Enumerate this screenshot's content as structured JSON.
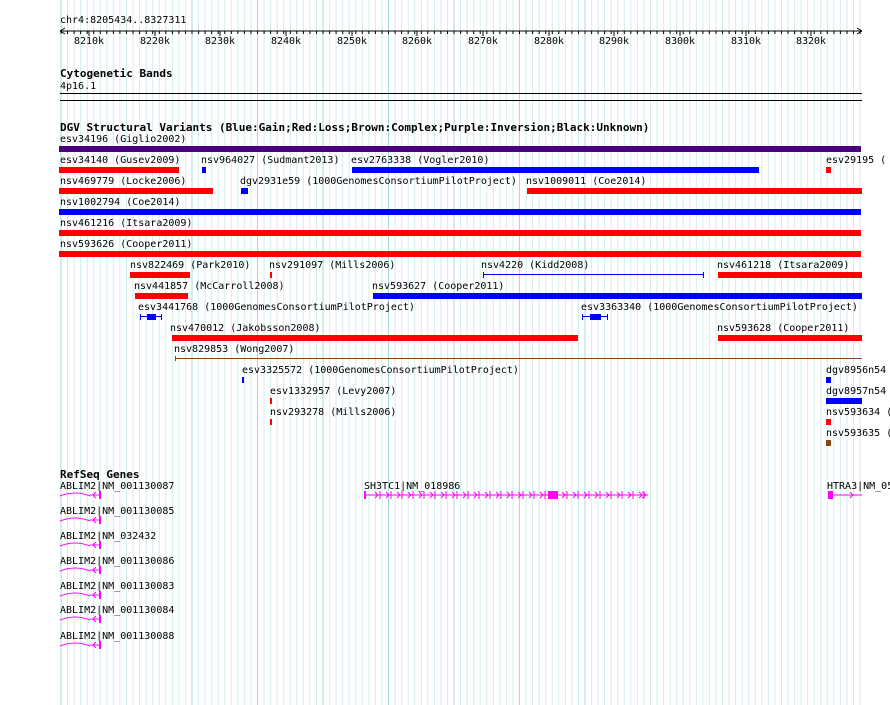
{
  "coordinate": "chr4:8205434..8327311",
  "axis_ticks": [
    "8210k",
    "8220k",
    "8230k",
    "8240k",
    "8250k",
    "8260k",
    "8270k",
    "8280k",
    "8290k",
    "8300k",
    "8310k",
    "8320k"
  ],
  "cytoband": {
    "title": "Cytogenetic Bands",
    "band": "4p16.1"
  },
  "dgv": {
    "title": "DGV Structural Variants (Blue:Gain;Red:Loss;Brown:Complex;Purple:Inversion;Black:Unknown)",
    "colors": {
      "gain": "#0000ff",
      "loss": "#ff0000",
      "complex": "#8b4513",
      "inversion": "#4b0082",
      "thin": "#b22222"
    },
    "features": [
      {
        "label": "esv34196 (Giglio2002)",
        "type": "inversion"
      },
      {
        "label": "esv34140 (Gusev2009)",
        "type": "loss"
      },
      {
        "label": "nsv964027 (Sudmant2013)",
        "type": "gain"
      },
      {
        "label": "esv2763338 (Vogler2010)",
        "type": "gain"
      },
      {
        "label": "esv29195 (",
        "type": "loss"
      },
      {
        "label": "nsv469779 (Locke2006)",
        "type": "loss"
      },
      {
        "label": "dgv2931e59 (1000GenomesConsortiumPilotProject)",
        "type": "gain"
      },
      {
        "label": "nsv1009011 (Coe2014)",
        "type": "loss"
      },
      {
        "label": "nsv1002794 (Coe2014)",
        "type": "gain"
      },
      {
        "label": "nsv461216 (Itsara2009)",
        "type": "loss"
      },
      {
        "label": "nsv593626 (Cooper2011)",
        "type": "loss"
      },
      {
        "label": "nsv822469 (Park2010)",
        "type": "loss"
      },
      {
        "label": "nsv291097 (Mills2006)",
        "type": "loss"
      },
      {
        "label": "nsv4220 (Kidd2008)",
        "type": "gain"
      },
      {
        "label": "nsv461218 (Itsara2009)",
        "type": "loss"
      },
      {
        "label": "nsv441857 (McCarroll2008)",
        "type": "loss"
      },
      {
        "label": "nsv593627 (Cooper2011)",
        "type": "gain"
      },
      {
        "label": "esv3441768 (1000GenomesConsortiumPilotProject)",
        "type": "gain"
      },
      {
        "label": "esv3363340 (1000GenomesConsortiumPilotProject)",
        "type": "gain"
      },
      {
        "label": "nsv470012 (Jakobsson2008)",
        "type": "loss"
      },
      {
        "label": "nsv593628 (Cooper2011)",
        "type": "loss"
      },
      {
        "label": "nsv829853 (Wong2007)",
        "type": "loss"
      },
      {
        "label": "esv3325572 (1000GenomesConsortiumPilotProject)",
        "type": "gain"
      },
      {
        "label": "dgv8956n54",
        "type": "gain"
      },
      {
        "label": "esv1332957 (Levy2007)",
        "type": "loss"
      },
      {
        "label": "dgv8957n54",
        "type": "gain"
      },
      {
        "label": "nsv293278 (Mills2006)",
        "type": "loss"
      },
      {
        "label": "nsv593634 (",
        "type": "loss"
      },
      {
        "label": "nsv593635 (",
        "type": "complex"
      }
    ]
  },
  "refseq": {
    "title": "RefSeq Genes",
    "color": "#ff00ff",
    "genes": [
      {
        "label": "ABLIM2|NM_001130087"
      },
      {
        "label": "ABLIM2|NM_001130085"
      },
      {
        "label": "ABLIM2|NM_032432"
      },
      {
        "label": "ABLIM2|NM_001130086"
      },
      {
        "label": "ABLIM2|NM_001130083"
      },
      {
        "label": "ABLIM2|NM_001130084"
      },
      {
        "label": "ABLIM2|NM_001130088"
      },
      {
        "label": "SH3TC1|NM_018986"
      },
      {
        "label": "HTRA3|NM_05"
      }
    ]
  }
}
